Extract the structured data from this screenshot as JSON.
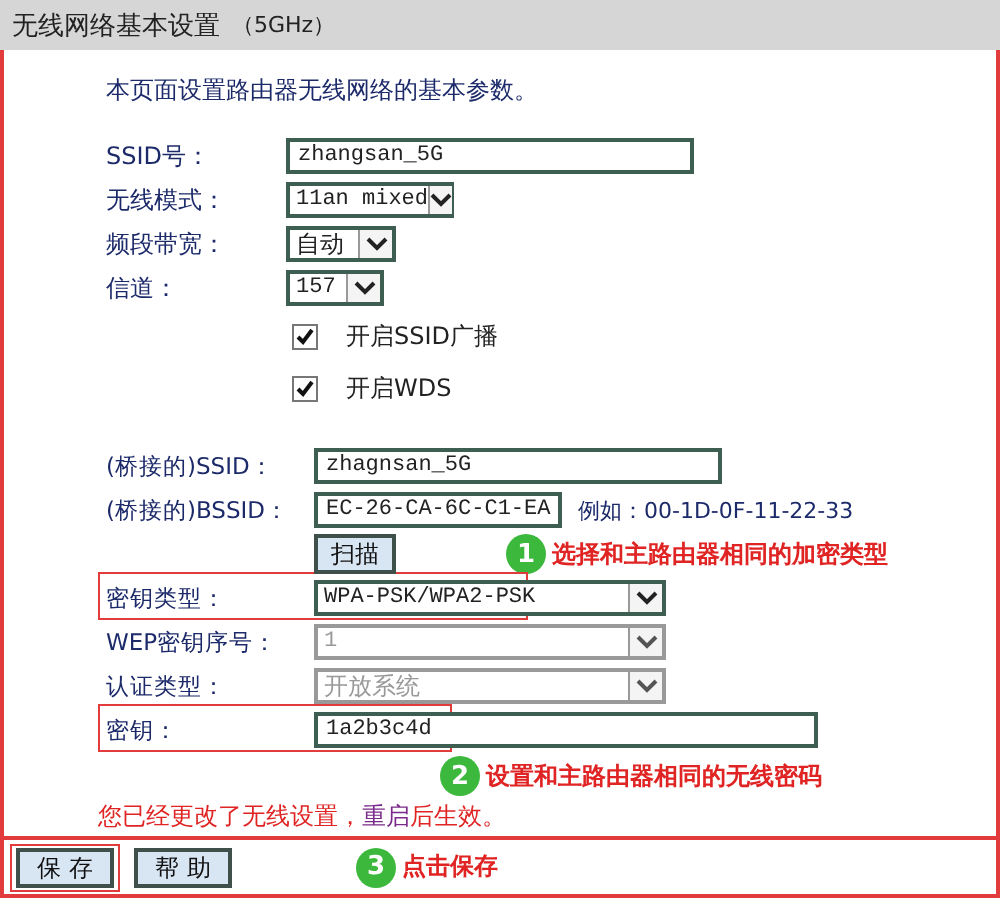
{
  "header": {
    "title": "无线网络基本设置",
    "subtitle": "（5GHz）"
  },
  "intro": "本页面设置路由器无线网络的基本参数。",
  "basic_fields": [
    {
      "kind": "text",
      "label": "SSID号：",
      "value": "zhangsan_5G"
    },
    {
      "kind": "select",
      "label": "无线模式：",
      "value": "11an mixed"
    },
    {
      "kind": "select",
      "label": "频段带宽：",
      "value": "自动"
    },
    {
      "kind": "select",
      "label": "信道：",
      "value": "157"
    },
    {
      "kind": "checkbox",
      "label": "开启SSID广播",
      "checked": true
    },
    {
      "kind": "checkbox",
      "label": "开启WDS",
      "checked": true
    }
  ],
  "bridge_fields": [
    {
      "kind": "text",
      "label": "(桥接的)SSID：",
      "value": "zhagnsan_5G",
      "disabled": false,
      "highlighted": false
    },
    {
      "kind": "bssid",
      "label": "(桥接的)BSSID：",
      "value": "EC-26-CA-6C-C1-EA",
      "example": "例如：00-1D-0F-11-22-33",
      "disabled": false,
      "highlighted": false
    },
    {
      "kind": "button",
      "label": "扫描",
      "highlighted": false
    },
    {
      "kind": "select",
      "label": "密钥类型：",
      "value": "WPA-PSK/WPA2-PSK",
      "disabled": false,
      "highlighted": true
    },
    {
      "kind": "select",
      "label": "WEP密钥序号：",
      "value": "1",
      "disabled": true,
      "highlighted": false
    },
    {
      "kind": "select",
      "label": "认证类型：",
      "value": "开放系统",
      "disabled": true,
      "highlighted": false
    },
    {
      "kind": "text",
      "label": "密钥：",
      "value": "1a2b3c4d",
      "disabled": false,
      "highlighted": true
    }
  ],
  "note": {
    "before": "您已经更改了无线设置，",
    "link": "重启",
    "after": "后生效。"
  },
  "buttons": [
    {
      "label": "保 存",
      "highlighted": true
    },
    {
      "label": "帮 助",
      "highlighted": false
    }
  ],
  "annotations": [
    {
      "number": "1",
      "text": "选择和主路由器相同的加密类型"
    },
    {
      "number": "2",
      "text": "设置和主路由器相同的无线密码"
    },
    {
      "number": "3",
      "text": "点击保存"
    }
  ]
}
